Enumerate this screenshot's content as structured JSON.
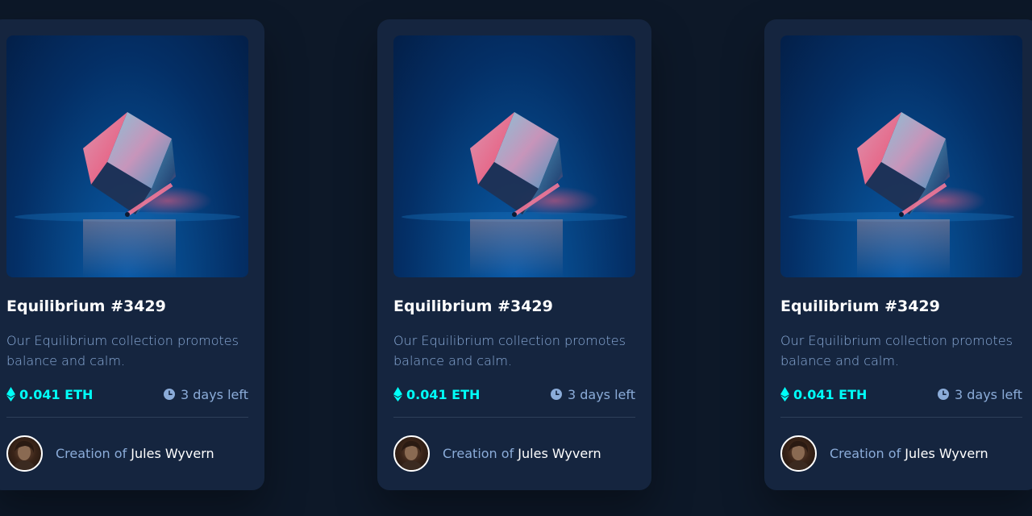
{
  "cards": [
    {
      "image_alt": "Equilibrium",
      "title": "Equilibrium #3429",
      "description": "Our Equilibrium collection promotes balance and calm.",
      "price": "0.041 ETH",
      "time_left": "3 days left",
      "creator_prefix": "Creation of",
      "creator_name": "Jules Wyvern",
      "icons": {
        "price": "ethereum-icon",
        "time": "clock-icon"
      }
    },
    {
      "image_alt": "Equilibrium",
      "title": "Equilibrium #3429",
      "description": "Our Equilibrium collection promotes balance and calm.",
      "price": "0.041 ETH",
      "time_left": "3 days left",
      "creator_prefix": "Creation of",
      "creator_name": "Jules Wyvern",
      "icons": {
        "price": "ethereum-icon",
        "time": "clock-icon"
      }
    },
    {
      "image_alt": "Equilibrium",
      "title": "Equilibrium #3429",
      "description": "Our Equilibrium collection promotes balance and calm.",
      "price": "0.041 ETH",
      "time_left": "3 days left",
      "creator_prefix": "Creation of",
      "creator_name": "Jules Wyvern",
      "icons": {
        "price": "ethereum-icon",
        "time": "clock-icon"
      }
    }
  ],
  "colors": {
    "background": "#0d1828",
    "card": "#15253f",
    "accent_cyan": "#00fff8",
    "soft_blue": "#8bacd9",
    "white": "#ffffff",
    "divider": "#2e405a"
  }
}
